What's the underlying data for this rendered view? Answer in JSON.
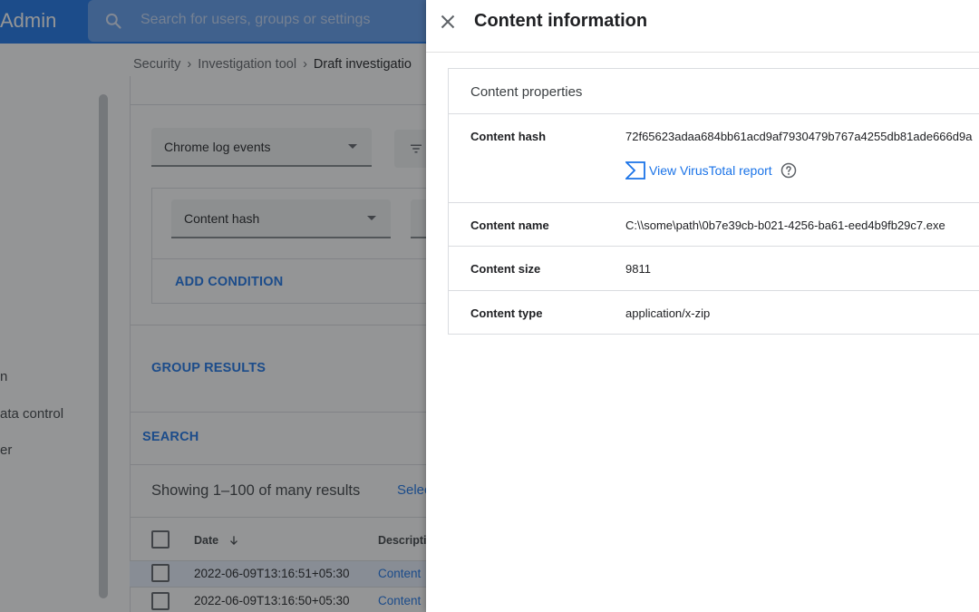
{
  "app": {
    "brand": "Admin",
    "search_placeholder": "Search for users, groups or settings"
  },
  "sidebar": {
    "items": [
      {
        "label": "n"
      },
      {
        "label": "ata control"
      },
      {
        "label": "er"
      }
    ]
  },
  "breadcrumb": {
    "items": [
      "Security",
      "Investigation tool",
      "Draft investigatio"
    ]
  },
  "query": {
    "data_source": "Chrome log events",
    "attribute": "Content hash",
    "add_condition_label": "ADD CONDITION",
    "group_results_label": "GROUP RESULTS",
    "search_label": "SEARCH"
  },
  "results": {
    "count_text": "Showing 1–100 of many results",
    "select_link": "Selec",
    "columns": {
      "date": "Date",
      "description": "Descriptio"
    },
    "rows": [
      {
        "date": "2022-06-09T13:16:51+05:30",
        "description": "Content"
      },
      {
        "date": "2022-06-09T13:16:50+05:30",
        "description": "Content"
      }
    ]
  },
  "panel": {
    "title": "Content information",
    "section_title": "Content properties",
    "properties": [
      {
        "key": "Content hash",
        "value": "72f65623adaa684bb61acd9af7930479b767a4255db81ade666d9a"
      },
      {
        "key": "Content name",
        "value": "C:\\\\some\\path\\0b7e39cb-b021-4256-ba61-eed4b9fb29c7.exe"
      },
      {
        "key": "Content size",
        "value": "9811"
      },
      {
        "key": "Content type",
        "value": "application/x-zip"
      }
    ],
    "virustotal_link": "View VirusTotal report"
  },
  "colors": {
    "accent": "#1a73e8",
    "topbar": "#1a73e8",
    "scrim": "rgba(32,33,36,0.48)"
  },
  "icons": [
    "search-icon",
    "close-icon",
    "virustotal-icon",
    "help-icon",
    "filter-icon",
    "sort-arrow-down-icon",
    "chevron-down-icon"
  ]
}
